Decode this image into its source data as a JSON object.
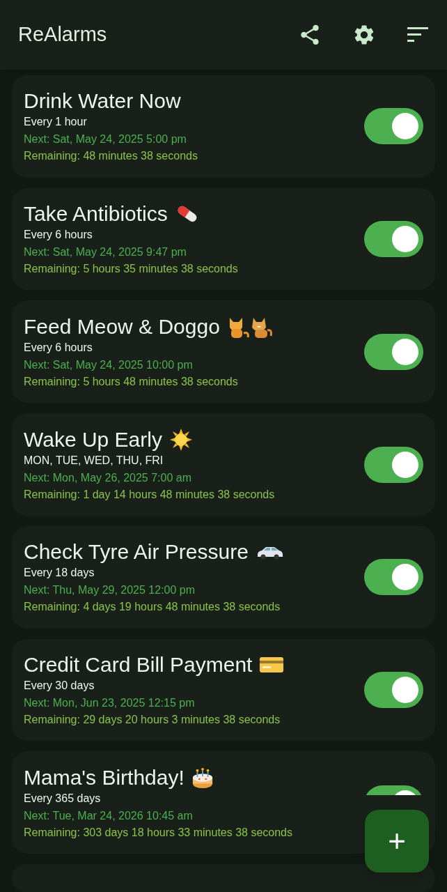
{
  "app_bar": {
    "title": "ReAlarms"
  },
  "alarms": [
    {
      "title": "Drink Water Now",
      "kind": "plain",
      "repeat": "Every 1 hour",
      "next": "Next: Sat, May 24, 2025 5:00 pm",
      "remaining": "Remaining: 48 minutes 38 seconds",
      "on": true
    },
    {
      "title": "Take Antibiotics",
      "kind": "pill",
      "repeat": "Every 6 hours",
      "next": "Next: Sat, May 24, 2025 9:47 pm",
      "remaining": "Remaining: 5 hours 35 minutes 38 seconds",
      "on": true
    },
    {
      "title": "Feed Meow & Doggo",
      "kind": "pets",
      "repeat": "Every 6 hours",
      "next": "Next: Sat, May 24, 2025 10:00 pm",
      "remaining": "Remaining: 5 hours 48 minutes 38 seconds",
      "on": true
    },
    {
      "title": "Wake Up Early",
      "kind": "sun",
      "repeat": "MON, TUE, WED, THU, FRI",
      "next": "Next: Mon, May 26, 2025 7:00 am",
      "remaining": "Remaining: 1 day 14 hours 48 minutes 38 seconds",
      "on": true
    },
    {
      "title": "Check Tyre Air Pressure",
      "kind": "car",
      "repeat": "Every 18 days",
      "next": "Next: Thu, May 29, 2025 12:00 pm",
      "remaining": "Remaining: 4 days 19 hours 48 minutes 38 seconds",
      "on": true
    },
    {
      "title": "Credit Card Bill Payment",
      "kind": "card",
      "repeat": "Every 30 days",
      "next": "Next: Mon, Jun 23, 2025 12:15 pm",
      "remaining": "Remaining: 29 days 20 hours 3 minutes 38 seconds",
      "on": true
    },
    {
      "title": "Mama's Birthday!",
      "kind": "cake",
      "repeat": "Every 365 days",
      "next": "Next: Tue, Mar 24, 2026 10:45 am",
      "remaining": "Remaining: 303 days 18 hours 33 minutes 38 seconds",
      "on": true
    }
  ],
  "fab": {
    "label": "+"
  }
}
